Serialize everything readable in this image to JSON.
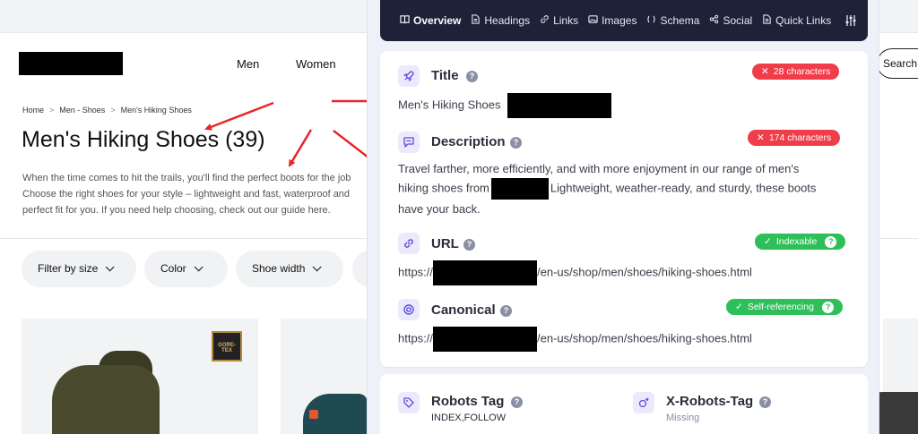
{
  "site": {
    "nav": [
      "Men",
      "Women"
    ],
    "search_label": "Search",
    "breadcrumb": [
      "Home",
      "Men - Shoes",
      "Men's Hiking Shoes"
    ],
    "breadcrumb_sep": ">",
    "title": "Men's Hiking Shoes (39)",
    "description_lines": [
      "When the time comes to hit the trails, you'll find the perfect boots for the job",
      "Choose the right shoes for your style – lightweight and fast, waterproof and",
      "perfect fit for you. If you need help choosing, check out our guide here."
    ],
    "filters": [
      "Filter by size",
      "Color",
      "Shoe width"
    ],
    "badge_text": "GORE-TEX"
  },
  "panel": {
    "tabs": [
      {
        "label": "Overview",
        "icon": "book-icon",
        "active": true
      },
      {
        "label": "Headings",
        "icon": "document-icon",
        "active": false
      },
      {
        "label": "Links",
        "icon": "link-icon",
        "active": false
      },
      {
        "label": "Images",
        "icon": "image-icon",
        "active": false
      },
      {
        "label": "Schema",
        "icon": "schema-icon",
        "active": false
      },
      {
        "label": "Social",
        "icon": "share-icon",
        "active": false
      },
      {
        "label": "Quick Links",
        "icon": "quick-links-icon",
        "active": false
      }
    ],
    "title": {
      "label": "Title",
      "help": "?",
      "badge": "28 characters",
      "badge_icon": "✕",
      "value": "Men's Hiking Shoes"
    },
    "description": {
      "label": "Description",
      "help": "?",
      "badge": "174 characters",
      "badge_icon": "✕",
      "line1": "Travel farther, more efficiently, and with more enjoyment in our range of men's",
      "line2_before": "hiking shoes from",
      "line2_after": "Lightweight, weather-ready, and sturdy, these boots",
      "line3": "have your back."
    },
    "url": {
      "label": "URL",
      "help": "?",
      "badge": "Indexable",
      "badge_icon": "✓",
      "prefix": "https://",
      "suffix": "/en-us/shop/men/shoes/hiking-shoes.html"
    },
    "canonical": {
      "label": "Canonical",
      "help": "?",
      "badge": "Self-referencing",
      "badge_icon": "✓",
      "prefix": "https://",
      "suffix": "/en-us/shop/men/shoes/hiking-shoes.html"
    },
    "robots": {
      "label": "Robots Tag",
      "help": "?",
      "value": "INDEX,FOLLOW"
    },
    "x_robots": {
      "label": "X-Robots-Tag",
      "help": "?",
      "value": "Missing"
    }
  },
  "colors": {
    "accent": "#5b4fe0",
    "error": "#ef3e4a",
    "success": "#2fbf5a",
    "navbar": "#1e2238",
    "arrow": "#e6262a"
  }
}
